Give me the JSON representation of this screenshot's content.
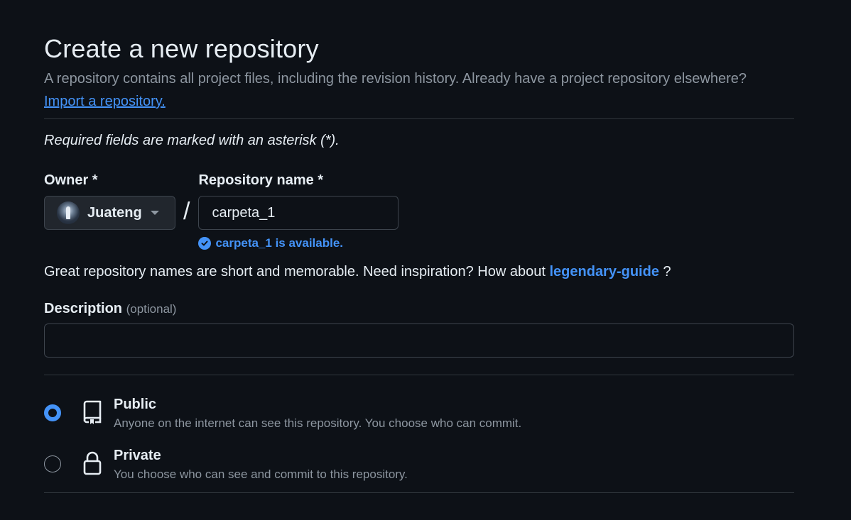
{
  "header": {
    "title": "Create a new repository",
    "subtitle": "A repository contains all project files, including the revision history. Already have a project repository elsewhere?",
    "import_link": "Import a repository."
  },
  "form": {
    "required_note": "Required fields are marked with an asterisk (*).",
    "owner": {
      "label": "Owner *",
      "value": "Juateng"
    },
    "slash": "/",
    "repo_name": {
      "label": "Repository name *",
      "value": "carpeta_1",
      "availability": "carpeta_1 is available."
    },
    "suggestion": {
      "prefix": "Great repository names are short and memorable. Need inspiration? How about",
      "name": "legendary-guide",
      "suffix": "?"
    },
    "description": {
      "label": "Description",
      "optional": "(optional)",
      "value": ""
    },
    "visibility": {
      "selected": "public",
      "public": {
        "title": "Public",
        "desc": "Anyone on the internet can see this repository. You choose who can commit."
      },
      "private": {
        "title": "Private",
        "desc": "You choose who can see and commit to this repository."
      }
    }
  },
  "colors": {
    "background": "#0d1117",
    "accent": "#4493f8",
    "muted_text": "#8d96a0",
    "border": "#3d444d"
  },
  "icons": {
    "owner_dropdown": "chevron-down-icon",
    "availability": "check-circle-icon",
    "public": "repo-icon",
    "private": "lock-icon"
  }
}
